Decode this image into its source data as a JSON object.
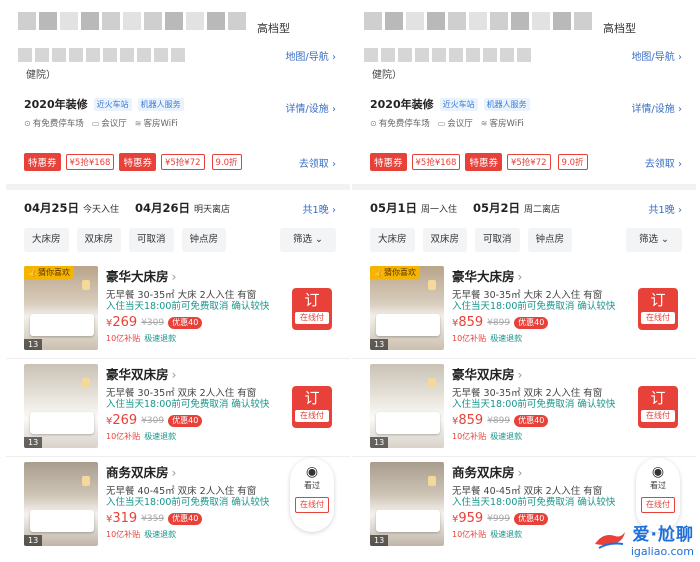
{
  "left": {
    "hotel_class": "高档型",
    "map_link": "地图/导航",
    "address_tail": "健院）",
    "renovation": "2020年装修",
    "tags": [
      "近火车站",
      "机器人服务"
    ],
    "facilities": [
      "有免费停车场",
      "会议厅",
      "客房WiFi"
    ],
    "details_link": "详情/设施",
    "coupons": {
      "label1": "特惠券",
      "value1": "¥5抢¥168",
      "label2": "特惠券",
      "value2": "¥5抢¥72",
      "discount": "9.0折",
      "claim": "去领取"
    },
    "checkin_date": "04月25日",
    "checkin_sub": "今天入住",
    "checkout_date": "04月26日",
    "checkout_sub": "明天离店",
    "nights": "共1晚",
    "filters": [
      "大床房",
      "双床房",
      "可取消",
      "钟点房"
    ],
    "filter_more": "筛选",
    "rooms": [
      {
        "badge": "猜你喜欢",
        "photo_count": "13",
        "name": "豪华大床房",
        "desc": "无早餐 30-35㎡ 大床 2人入住 有窗",
        "policy": "入住当天18:00前可免费取消 确认较快",
        "price": "269",
        "price_old": "¥309",
        "discount": "优惠40",
        "tag1": "10亿补贴",
        "tag2": "极速退款",
        "book": "订",
        "pay": "在线付"
      },
      {
        "badge": "",
        "photo_count": "13",
        "name": "豪华双床房",
        "desc": "无早餐 30-35㎡ 双床 2人入住 有窗",
        "policy": "入住当天18:00前可免费取消 确认较快",
        "price": "269",
        "price_old": "¥309",
        "discount": "优惠40",
        "tag1": "10亿补贴",
        "tag2": "极速退款",
        "book": "订",
        "pay": "在线付"
      },
      {
        "badge": "",
        "photo_count": "13",
        "name": "商务双床房",
        "desc": "无早餐 40-45㎡ 双床 2人入住 有窗",
        "policy": "入住当天18:00前可免费取消 确认较快",
        "price": "319",
        "price_old": "¥359",
        "discount": "优惠40",
        "tag1": "10亿补贴",
        "tag2": "极速退款",
        "viewed": "看过",
        "pay": "在线付"
      }
    ]
  },
  "right": {
    "hotel_class": "高档型",
    "map_link": "地图/导航",
    "address_tail": "健院）",
    "renovation": "2020年装修",
    "tags": [
      "近火车站",
      "机器人服务"
    ],
    "facilities": [
      "有免费停车场",
      "会议厅",
      "客房WiFi"
    ],
    "details_link": "详情/设施",
    "coupons": {
      "label1": "特惠券",
      "value1": "¥5抢¥168",
      "label2": "特惠券",
      "value2": "¥5抢¥72",
      "discount": "9.0折",
      "claim": "去领取"
    },
    "checkin_date": "05月1日",
    "checkin_sub": "周一入住",
    "checkout_date": "05月2日",
    "checkout_sub": "周二离店",
    "nights": "共1晚",
    "filters": [
      "大床房",
      "双床房",
      "可取消",
      "钟点房"
    ],
    "filter_more": "筛选",
    "rooms": [
      {
        "badge": "猜你喜欢",
        "photo_count": "13",
        "name": "豪华大床房",
        "desc": "无早餐 30-35㎡ 大床 2人入住 有窗",
        "policy": "入住当天18:00前可免费取消 确认较快",
        "price": "859",
        "price_old": "¥899",
        "discount": "优惠40",
        "tag1": "10亿补贴",
        "tag2": "极速退款",
        "book": "订",
        "pay": "在线付"
      },
      {
        "badge": "",
        "photo_count": "13",
        "name": "豪华双床房",
        "desc": "无早餐 30-35㎡ 双床 2人入住 有窗",
        "policy": "入住当天18:00前可免费取消 确认较快",
        "price": "859",
        "price_old": "¥899",
        "discount": "优惠40",
        "tag1": "10亿补贴",
        "tag2": "极速退款",
        "book": "订",
        "pay": "在线付"
      },
      {
        "badge": "",
        "photo_count": "13",
        "name": "商务双床房",
        "desc": "无早餐 40-45㎡ 双床 2人入住 有窗",
        "policy": "入住当天18:00前可免费取消 确认较快",
        "price": "959",
        "price_old": "¥999",
        "discount": "优惠40",
        "tag1": "10亿补贴",
        "tag2": "极速退款",
        "viewed": "看过",
        "pay": "在线付"
      }
    ]
  },
  "watermark": {
    "cn": "爱·尬聊",
    "url": "igaliao.com"
  },
  "colors": {
    "accent_red": "#e8413a",
    "link_blue": "#3a6fc4",
    "policy_teal": "#17958a"
  }
}
